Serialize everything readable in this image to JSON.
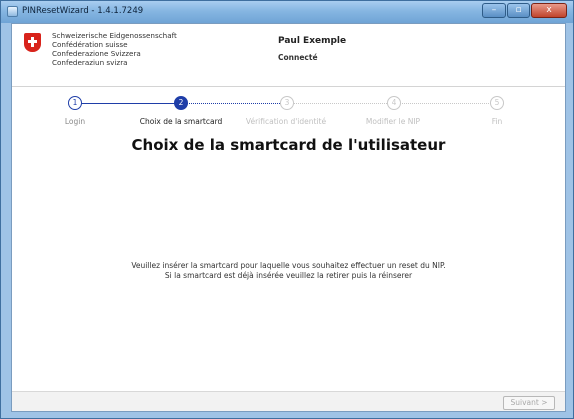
{
  "window": {
    "title": "PINResetWizard - 1.4.1.7249",
    "minimize": "–",
    "maximize": "▫",
    "close": "x"
  },
  "header": {
    "org_lines": [
      "Schweizerische Eidgenossenschaft",
      "Confédération suisse",
      "Confederazione Svizzera",
      "Confederaziun svizra"
    ],
    "user_name": "Paul Exemple",
    "user_status": "Connecté"
  },
  "steps": [
    {
      "number": "1",
      "label": "Login",
      "state": "done"
    },
    {
      "number": "2",
      "label": "Choix de la smartcard",
      "state": "active"
    },
    {
      "number": "3",
      "label": "Vérification d'identité",
      "state": "todo"
    },
    {
      "number": "4",
      "label": "Modifier le NIP",
      "state": "todo"
    },
    {
      "number": "5",
      "label": "Fin",
      "state": "todo"
    }
  ],
  "main": {
    "title": "Choix de la smartcard de l'utilisateur",
    "instruction_line1": "Veuillez insérer la smartcard pour laquelle vous souhaitez effectuer un reset du NIP.",
    "instruction_line2": "Si la smartcard est déjà insérée veuillez la retirer puis la réinserer"
  },
  "footer": {
    "next_label": "Suivant >"
  },
  "colors": {
    "accent": "#1f3ea8",
    "swiss_red": "#d8231b",
    "inactive": "#c8c8c8"
  }
}
